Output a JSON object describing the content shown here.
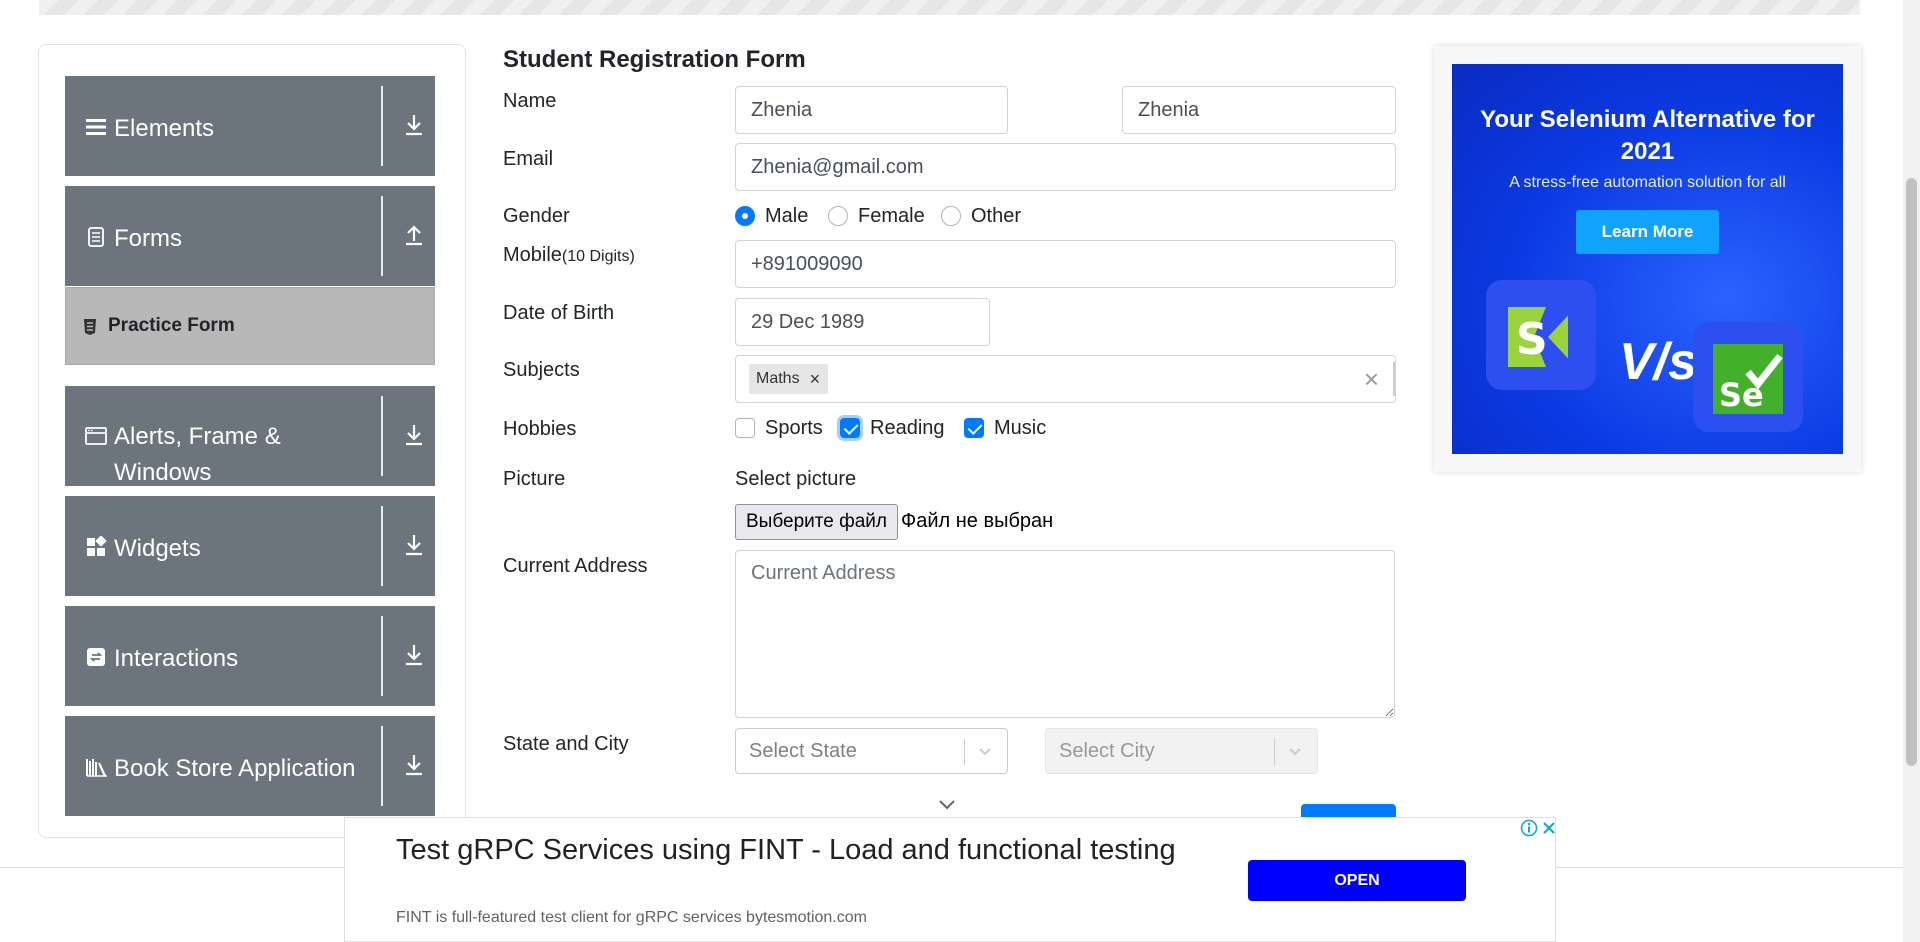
{
  "sidebar": {
    "groups": [
      {
        "title": "Elements",
        "icon": "menu-icon",
        "toggle": "download-icon"
      },
      {
        "title": "Forms",
        "icon": "document-icon",
        "toggle": "upload-icon"
      },
      {
        "title": "Alerts, Frame & Windows",
        "icon": "window-icon",
        "toggle": "download-icon"
      },
      {
        "title": "Widgets",
        "icon": "widgets-icon",
        "toggle": "download-icon"
      },
      {
        "title": "Interactions",
        "icon": "interactions-icon",
        "toggle": "download-icon"
      },
      {
        "title": "Book Store Application",
        "icon": "books-icon",
        "toggle": "download-icon"
      }
    ],
    "active_item": {
      "label": "Practice Form",
      "icon": "form-icon"
    }
  },
  "form": {
    "title": "Student Registration Form",
    "name": {
      "label": "Name",
      "first_value": "Zhenia",
      "last_value": "Zhenia"
    },
    "email": {
      "label": "Email",
      "value": "Zhenia@gmail.com"
    },
    "gender": {
      "label": "Gender",
      "options": [
        "Male",
        "Female",
        "Other"
      ],
      "selected": "Male"
    },
    "mobile": {
      "label": "Mobile",
      "hint": "(10 Digits)",
      "value": "+891009090"
    },
    "dob": {
      "label": "Date of Birth",
      "value": "29 Dec 1989"
    },
    "subjects": {
      "label": "Subjects",
      "chips": [
        "Maths"
      ],
      "clear_icon": "clear-icon"
    },
    "hobbies": {
      "label": "Hobbies",
      "options": [
        "Sports",
        "Reading",
        "Music"
      ],
      "checked": [
        "Reading",
        "Music"
      ]
    },
    "picture": {
      "label": "Picture",
      "prompt": "Select picture",
      "button": "Выберите файл",
      "status": "Файл не выбран"
    },
    "address": {
      "label": "Current Address",
      "placeholder": "Current Address"
    },
    "state_city": {
      "label": "State and City",
      "state_placeholder": "Select State",
      "city_placeholder": "Select City"
    }
  },
  "ad_right": {
    "headline": "Your Selenium Alternative for 2021",
    "subtext": "A stress-free automation solution for all",
    "cta": "Learn More",
    "vs": "V/s"
  },
  "ad_bottom": {
    "title": "Test gRPC Services using FINT - Load and functional testing",
    "description": "FINT is full-featured test client for gRPC services bytesmotion.com",
    "cta": "OPEN"
  },
  "colors": {
    "primary": "#007bff",
    "sidebar": "#6c757d",
    "sidebar_active": "#b8b8b8",
    "ad_blue": "#0000ff"
  }
}
